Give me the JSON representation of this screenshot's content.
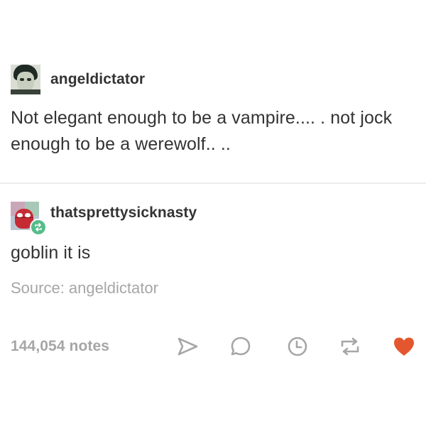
{
  "post": {
    "first": {
      "username": "angeldictator",
      "text": "Not elegant enough to be a vampire.... . not jock enough to be a werewolf.. .."
    },
    "second": {
      "username": "thatsprettysicknasty",
      "text": "goblin it is"
    },
    "source": "Source: angeldictator",
    "notes": "144,054 notes"
  },
  "icons": {
    "share": "share-icon",
    "reply": "reply-icon",
    "queue": "clock-icon",
    "reblog": "reblog-icon",
    "like": "heart-icon"
  },
  "colors": {
    "gray_icon": "#a6a6a6",
    "like": "#e4572e",
    "reblog_badge": "#56bc8a",
    "text": "#333333"
  }
}
